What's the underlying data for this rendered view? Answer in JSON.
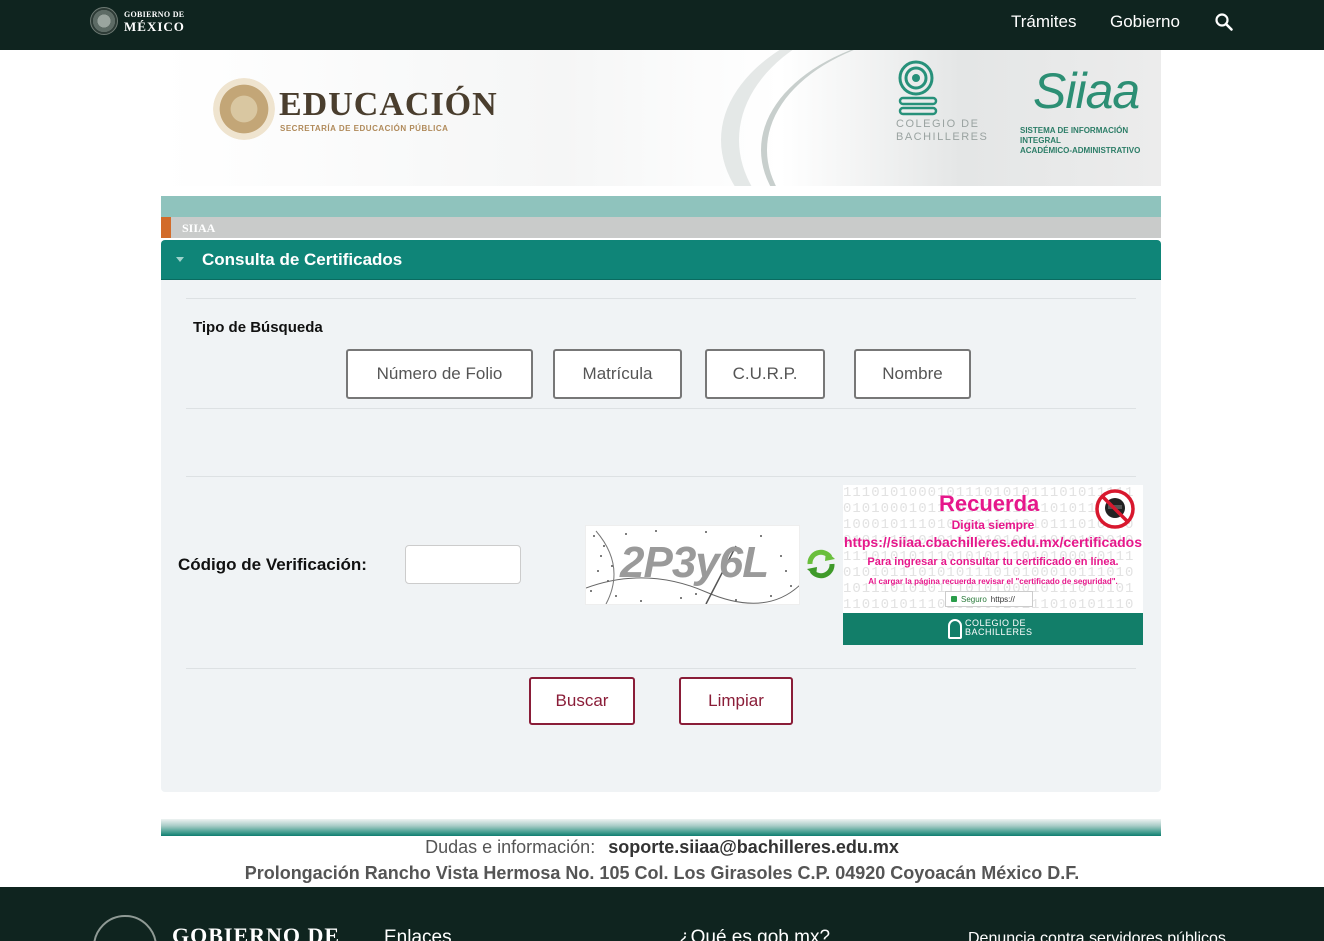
{
  "topbar": {
    "logo_line1": "GOBIERNO DE",
    "logo_line2": "MÉXICO",
    "nav": [
      "Trámites",
      "Gobierno"
    ],
    "search_icon": "search-icon"
  },
  "banner": {
    "sep_title": "EDUCACIÓN",
    "sep_subtitle": "SECRETARÍA DE EDUCACIÓN PÚBLICA",
    "cb_text_line1": "COLEGIO DE",
    "cb_text_line2": "BACHILLERES",
    "siiaa_word": "Siiaa",
    "siiaa_sub_line1": "SISTEMA DE INFORMACIÓN INTEGRAL",
    "siiaa_sub_line2": "ACADÉMICO-ADMINISTRATIVO"
  },
  "breadcrumb": {
    "label": "SIIAA"
  },
  "panel": {
    "title": "Consulta de Certificados",
    "tipo_label": "Tipo de Búsqueda",
    "options": [
      "Número de Folio",
      "Matrícula",
      "C.U.R.P.",
      "Nombre"
    ],
    "codigo_label": "Código de Verificación:",
    "codigo_value": "",
    "captcha_text": "2P3y6L",
    "buttons": {
      "buscar": "Buscar",
      "limpiar": "Limpiar"
    }
  },
  "recuerda": {
    "title": "Recuerda",
    "line1": "Digita siempre",
    "url": "https://siiaa.cbachilleres.edu.mx/certificados",
    "line2": "Para ingresar a consultar tu certificado en línea.",
    "line3": "Al cargar la página recuerda revisar el \"certificado de seguridad\".",
    "secure_label": "Seguro",
    "secure_url": "https://",
    "footer_line1": "COLEGIO DE",
    "footer_line2": "BACHILLERES",
    "bg_digits": "1110101000101110101011101011111010100010111010101110101011101010001011101010111010101110101000101110101011101010111010100010111010101110101011101010001011101010111010101110101000101110101011101010111010100010111010101110101011101010001011101010111010101110101000101110101011101010"
  },
  "footer": {
    "dudas_label": "Dudas e información:",
    "email": "soporte.siiaa@bachilleres.edu.mx",
    "address": "Prolongación Rancho Vista Hermosa No. 105 Col. Los Girasoles C.P. 04920 Coyoacán México D.F.",
    "gob_label": "GOBIERNO DE",
    "links": [
      "Enlaces",
      "¿Qué es gob.mx?",
      "Denuncia contra servidores públicos"
    ]
  }
}
